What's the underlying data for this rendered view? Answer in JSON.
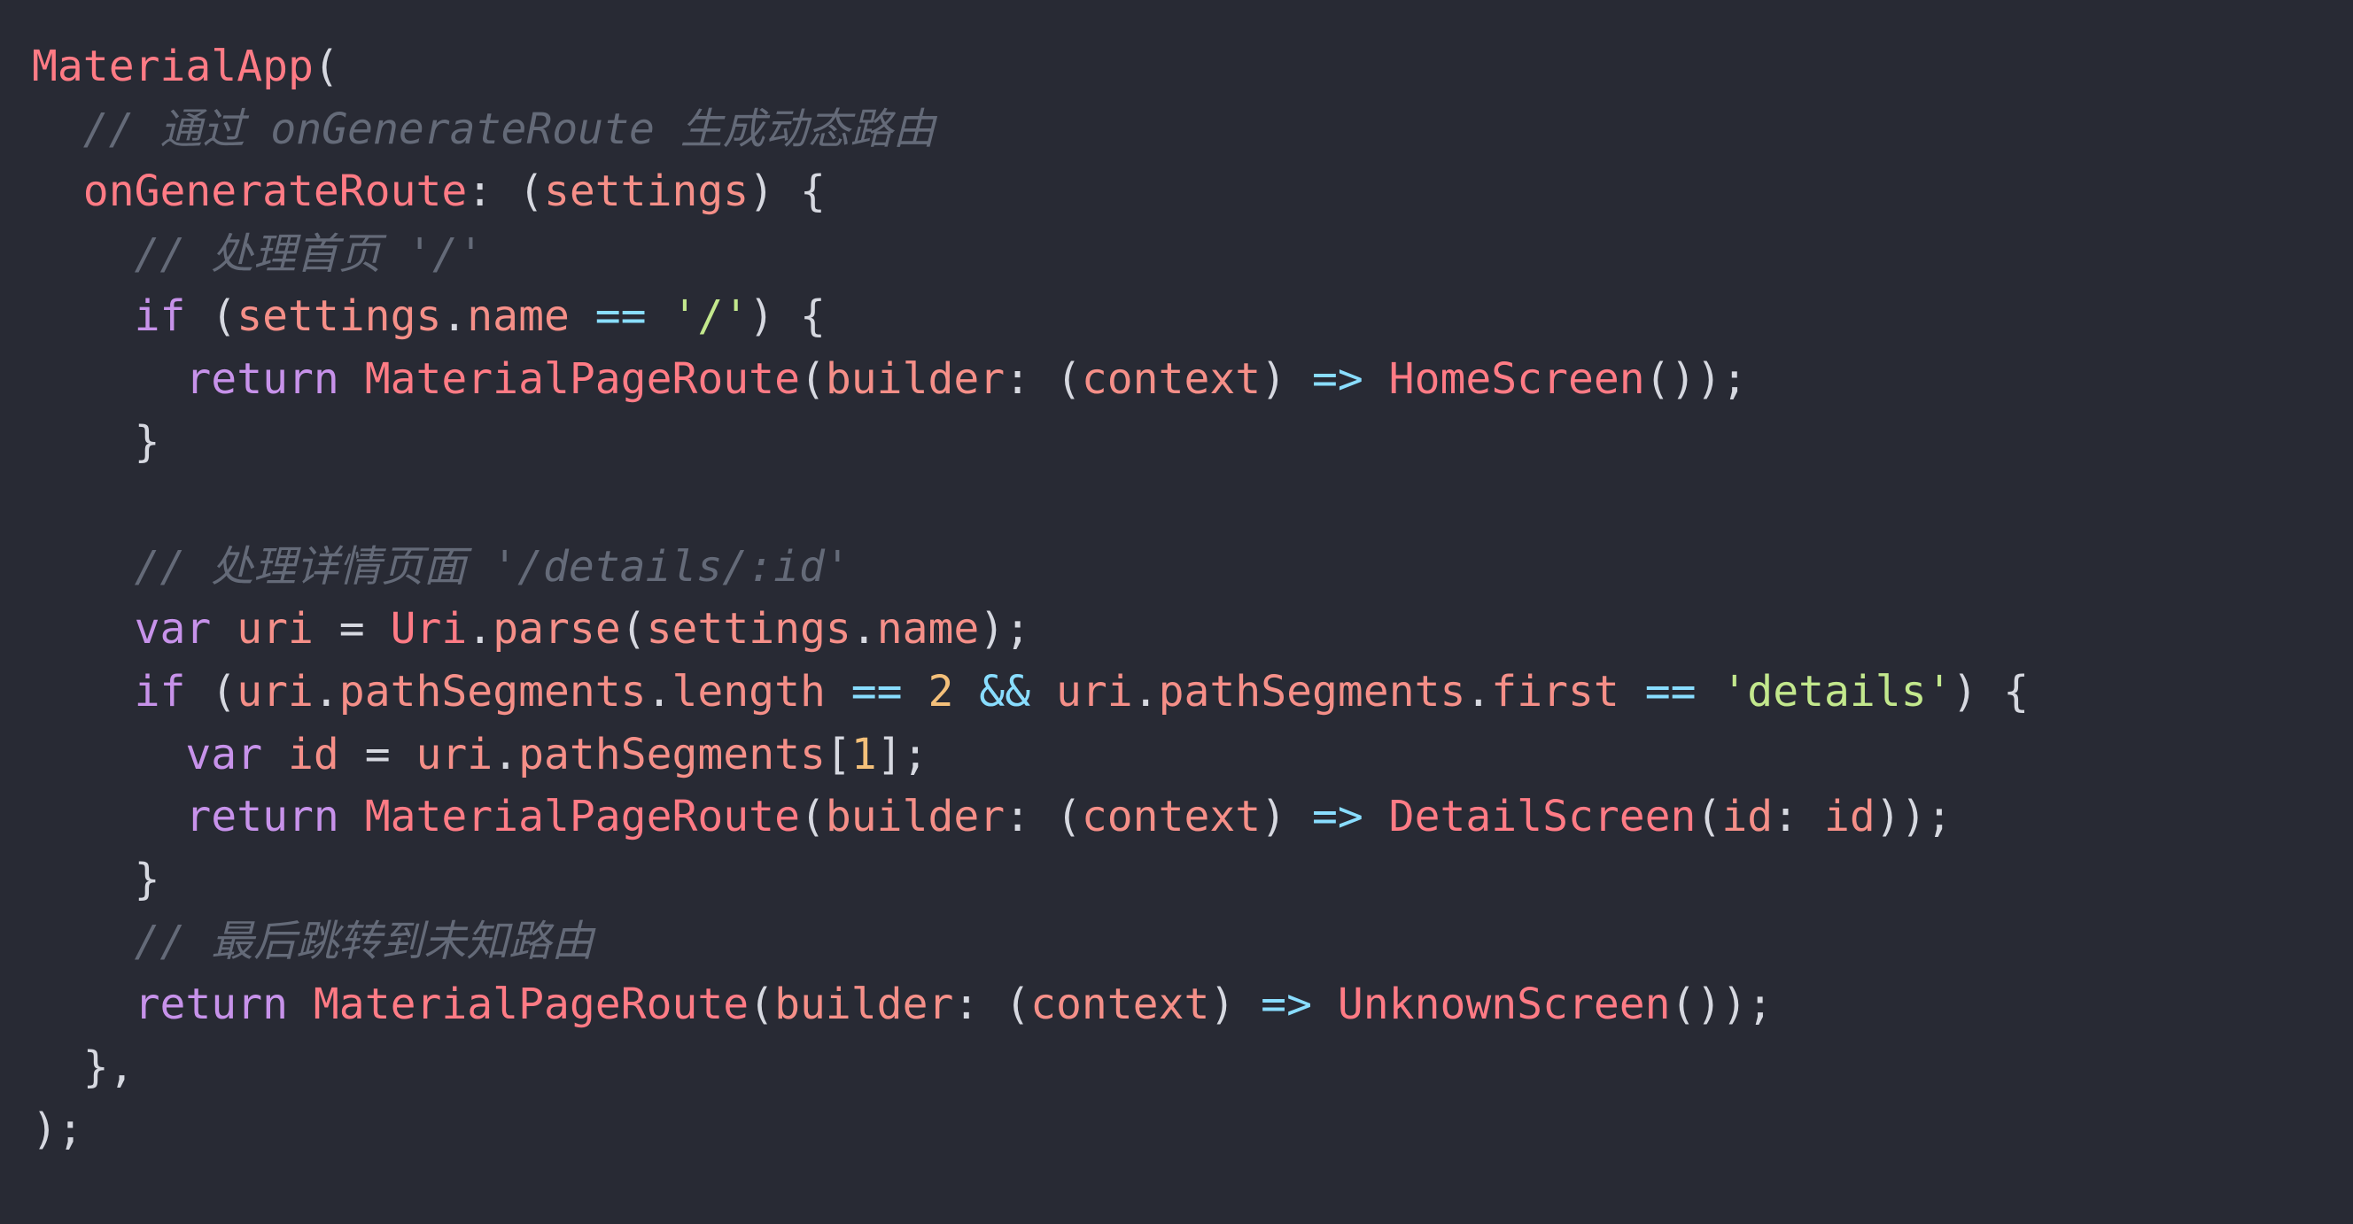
{
  "colors": {
    "background": "#282a34",
    "punct": "#d6d8e0",
    "keyword": "#c792ea",
    "ident": "#ff7b85",
    "prop": "#f58f88",
    "comment": "#646a78",
    "string": "#c3e88d",
    "number": "#f4c07a",
    "operator": "#89ddff"
  },
  "lines": [
    [
      {
        "text": "MaterialApp",
        "kind": "ident"
      },
      {
        "text": "(",
        "kind": "punct"
      }
    ],
    [
      {
        "text": "  ",
        "kind": "punct"
      },
      {
        "text": "// 通过 onGenerateRoute 生成动态路由",
        "kind": "comment"
      }
    ],
    [
      {
        "text": "  ",
        "kind": "punct"
      },
      {
        "text": "onGenerateRoute",
        "kind": "ident"
      },
      {
        "text": ": (",
        "kind": "punct"
      },
      {
        "text": "settings",
        "kind": "prop"
      },
      {
        "text": ") {",
        "kind": "punct"
      }
    ],
    [
      {
        "text": "    ",
        "kind": "punct"
      },
      {
        "text": "// 处理首页 '/'",
        "kind": "comment"
      }
    ],
    [
      {
        "text": "    ",
        "kind": "punct"
      },
      {
        "text": "if",
        "kind": "keyword"
      },
      {
        "text": " (",
        "kind": "punct"
      },
      {
        "text": "settings",
        "kind": "prop"
      },
      {
        "text": ".",
        "kind": "punct"
      },
      {
        "text": "name",
        "kind": "prop"
      },
      {
        "text": " ",
        "kind": "punct"
      },
      {
        "text": "==",
        "kind": "operator"
      },
      {
        "text": " ",
        "kind": "punct"
      },
      {
        "text": "'/'",
        "kind": "string"
      },
      {
        "text": ") {",
        "kind": "punct"
      }
    ],
    [
      {
        "text": "      ",
        "kind": "punct"
      },
      {
        "text": "return",
        "kind": "keyword"
      },
      {
        "text": " ",
        "kind": "punct"
      },
      {
        "text": "MaterialPageRoute",
        "kind": "ident"
      },
      {
        "text": "(",
        "kind": "punct"
      },
      {
        "text": "builder",
        "kind": "prop"
      },
      {
        "text": ": (",
        "kind": "punct"
      },
      {
        "text": "context",
        "kind": "prop"
      },
      {
        "text": ") ",
        "kind": "punct"
      },
      {
        "text": "=>",
        "kind": "operator"
      },
      {
        "text": " ",
        "kind": "punct"
      },
      {
        "text": "HomeScreen",
        "kind": "ident"
      },
      {
        "text": "());",
        "kind": "punct"
      }
    ],
    [
      {
        "text": "    }",
        "kind": "punct"
      }
    ],
    [],
    [
      {
        "text": "    ",
        "kind": "punct"
      },
      {
        "text": "// 处理详情页面 '/details/:id'",
        "kind": "comment"
      }
    ],
    [
      {
        "text": "    ",
        "kind": "punct"
      },
      {
        "text": "var",
        "kind": "keyword"
      },
      {
        "text": " ",
        "kind": "punct"
      },
      {
        "text": "uri",
        "kind": "prop"
      },
      {
        "text": " = ",
        "kind": "punct"
      },
      {
        "text": "Uri",
        "kind": "ident"
      },
      {
        "text": ".",
        "kind": "punct"
      },
      {
        "text": "parse",
        "kind": "prop"
      },
      {
        "text": "(",
        "kind": "punct"
      },
      {
        "text": "settings",
        "kind": "prop"
      },
      {
        "text": ".",
        "kind": "punct"
      },
      {
        "text": "name",
        "kind": "prop"
      },
      {
        "text": ");",
        "kind": "punct"
      }
    ],
    [
      {
        "text": "    ",
        "kind": "punct"
      },
      {
        "text": "if",
        "kind": "keyword"
      },
      {
        "text": " (",
        "kind": "punct"
      },
      {
        "text": "uri",
        "kind": "prop"
      },
      {
        "text": ".",
        "kind": "punct"
      },
      {
        "text": "pathSegments",
        "kind": "prop"
      },
      {
        "text": ".",
        "kind": "punct"
      },
      {
        "text": "length",
        "kind": "prop"
      },
      {
        "text": " ",
        "kind": "punct"
      },
      {
        "text": "==",
        "kind": "operator"
      },
      {
        "text": " ",
        "kind": "punct"
      },
      {
        "text": "2",
        "kind": "number"
      },
      {
        "text": " ",
        "kind": "punct"
      },
      {
        "text": "&&",
        "kind": "operator"
      },
      {
        "text": " ",
        "kind": "punct"
      },
      {
        "text": "uri",
        "kind": "prop"
      },
      {
        "text": ".",
        "kind": "punct"
      },
      {
        "text": "pathSegments",
        "kind": "prop"
      },
      {
        "text": ".",
        "kind": "punct"
      },
      {
        "text": "first",
        "kind": "prop"
      },
      {
        "text": " ",
        "kind": "punct"
      },
      {
        "text": "==",
        "kind": "operator"
      },
      {
        "text": " ",
        "kind": "punct"
      },
      {
        "text": "'details'",
        "kind": "string"
      },
      {
        "text": ") {",
        "kind": "punct"
      }
    ],
    [
      {
        "text": "      ",
        "kind": "punct"
      },
      {
        "text": "var",
        "kind": "keyword"
      },
      {
        "text": " ",
        "kind": "punct"
      },
      {
        "text": "id",
        "kind": "prop"
      },
      {
        "text": " = ",
        "kind": "punct"
      },
      {
        "text": "uri",
        "kind": "prop"
      },
      {
        "text": ".",
        "kind": "punct"
      },
      {
        "text": "pathSegments",
        "kind": "prop"
      },
      {
        "text": "[",
        "kind": "punct"
      },
      {
        "text": "1",
        "kind": "number"
      },
      {
        "text": "];",
        "kind": "punct"
      }
    ],
    [
      {
        "text": "      ",
        "kind": "punct"
      },
      {
        "text": "return",
        "kind": "keyword"
      },
      {
        "text": " ",
        "kind": "punct"
      },
      {
        "text": "MaterialPageRoute",
        "kind": "ident"
      },
      {
        "text": "(",
        "kind": "punct"
      },
      {
        "text": "builder",
        "kind": "prop"
      },
      {
        "text": ": (",
        "kind": "punct"
      },
      {
        "text": "context",
        "kind": "prop"
      },
      {
        "text": ") ",
        "kind": "punct"
      },
      {
        "text": "=>",
        "kind": "operator"
      },
      {
        "text": " ",
        "kind": "punct"
      },
      {
        "text": "DetailScreen",
        "kind": "ident"
      },
      {
        "text": "(",
        "kind": "punct"
      },
      {
        "text": "id",
        "kind": "prop"
      },
      {
        "text": ": ",
        "kind": "punct"
      },
      {
        "text": "id",
        "kind": "prop"
      },
      {
        "text": "));",
        "kind": "punct"
      }
    ],
    [
      {
        "text": "    }",
        "kind": "punct"
      }
    ],
    [
      {
        "text": "    ",
        "kind": "punct"
      },
      {
        "text": "// 最后跳转到未知路由",
        "kind": "comment"
      }
    ],
    [
      {
        "text": "    ",
        "kind": "punct"
      },
      {
        "text": "return",
        "kind": "keyword"
      },
      {
        "text": " ",
        "kind": "punct"
      },
      {
        "text": "MaterialPageRoute",
        "kind": "ident"
      },
      {
        "text": "(",
        "kind": "punct"
      },
      {
        "text": "builder",
        "kind": "prop"
      },
      {
        "text": ": (",
        "kind": "punct"
      },
      {
        "text": "context",
        "kind": "prop"
      },
      {
        "text": ") ",
        "kind": "punct"
      },
      {
        "text": "=>",
        "kind": "operator"
      },
      {
        "text": " ",
        "kind": "punct"
      },
      {
        "text": "UnknownScreen",
        "kind": "ident"
      },
      {
        "text": "());",
        "kind": "punct"
      }
    ],
    [
      {
        "text": "  },",
        "kind": "punct"
      }
    ],
    [
      {
        "text": ");",
        "kind": "punct"
      }
    ]
  ]
}
